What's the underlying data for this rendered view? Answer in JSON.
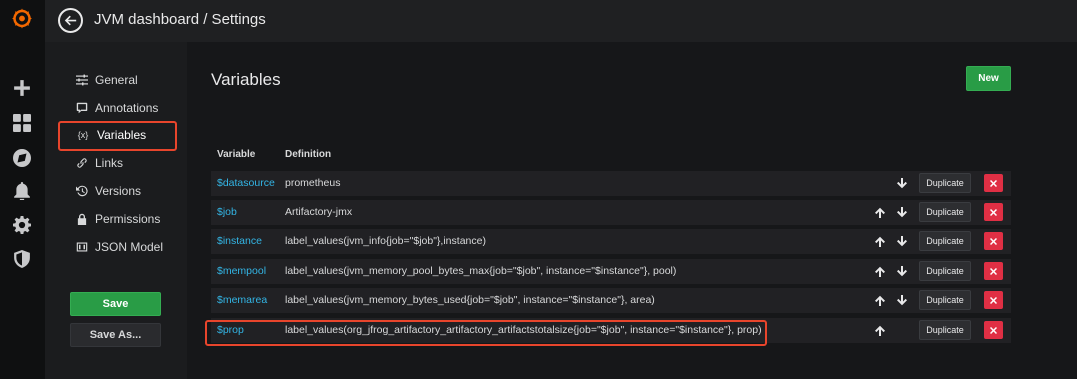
{
  "header": {
    "title": "JVM dashboard / Settings"
  },
  "sidebar": {
    "items": [
      {
        "label": "General",
        "icon": "sliders-icon"
      },
      {
        "label": "Annotations",
        "icon": "comment-icon"
      },
      {
        "label": "Variables",
        "icon": "variable-icon",
        "active": true
      },
      {
        "label": "Links",
        "icon": "link-icon"
      },
      {
        "label": "Versions",
        "icon": "history-icon"
      },
      {
        "label": "Permissions",
        "icon": "lock-icon"
      },
      {
        "label": "JSON Model",
        "icon": "json-icon"
      }
    ],
    "variable_icon_glyph": "{x}",
    "save_label": "Save",
    "save_as_label": "Save As..."
  },
  "main": {
    "heading": "Variables",
    "new_label": "New",
    "columns": {
      "variable": "Variable",
      "definition": "Definition"
    },
    "duplicate_label": "Duplicate",
    "rows": [
      {
        "name": "$datasource",
        "definition": "prometheus",
        "up": false,
        "down": true
      },
      {
        "name": "$job",
        "definition": "Artifactory-jmx",
        "up": true,
        "down": true
      },
      {
        "name": "$instance",
        "definition": "label_values(jvm_info{job=\"$job\"},instance)",
        "up": true,
        "down": true
      },
      {
        "name": "$mempool",
        "definition": "label_values(jvm_memory_pool_bytes_max{job=\"$job\", instance=\"$instance\"}, pool)",
        "up": true,
        "down": true
      },
      {
        "name": "$memarea",
        "definition": "label_values(jvm_memory_bytes_used{job=\"$job\", instance=\"$instance\"}, area)",
        "up": true,
        "down": true
      },
      {
        "name": "$prop",
        "definition": "label_values(org_jfrog_artifactory_artifactory_artifactstotalsize{job=\"$job\", instance=\"$instance\"}, prop)",
        "up": true,
        "down": false
      }
    ]
  },
  "colors": {
    "accent_link": "#33b5e5",
    "primary_green": "#299c46",
    "danger_red": "#e02f44",
    "highlight_annotation": "#e8452c",
    "grafana_logo": "#f46800"
  },
  "rail_icons": [
    "grafana-logo-icon",
    "plus-icon",
    "dashboards-icon",
    "explore-icon",
    "bell-icon",
    "gear-icon",
    "shield-icon"
  ]
}
